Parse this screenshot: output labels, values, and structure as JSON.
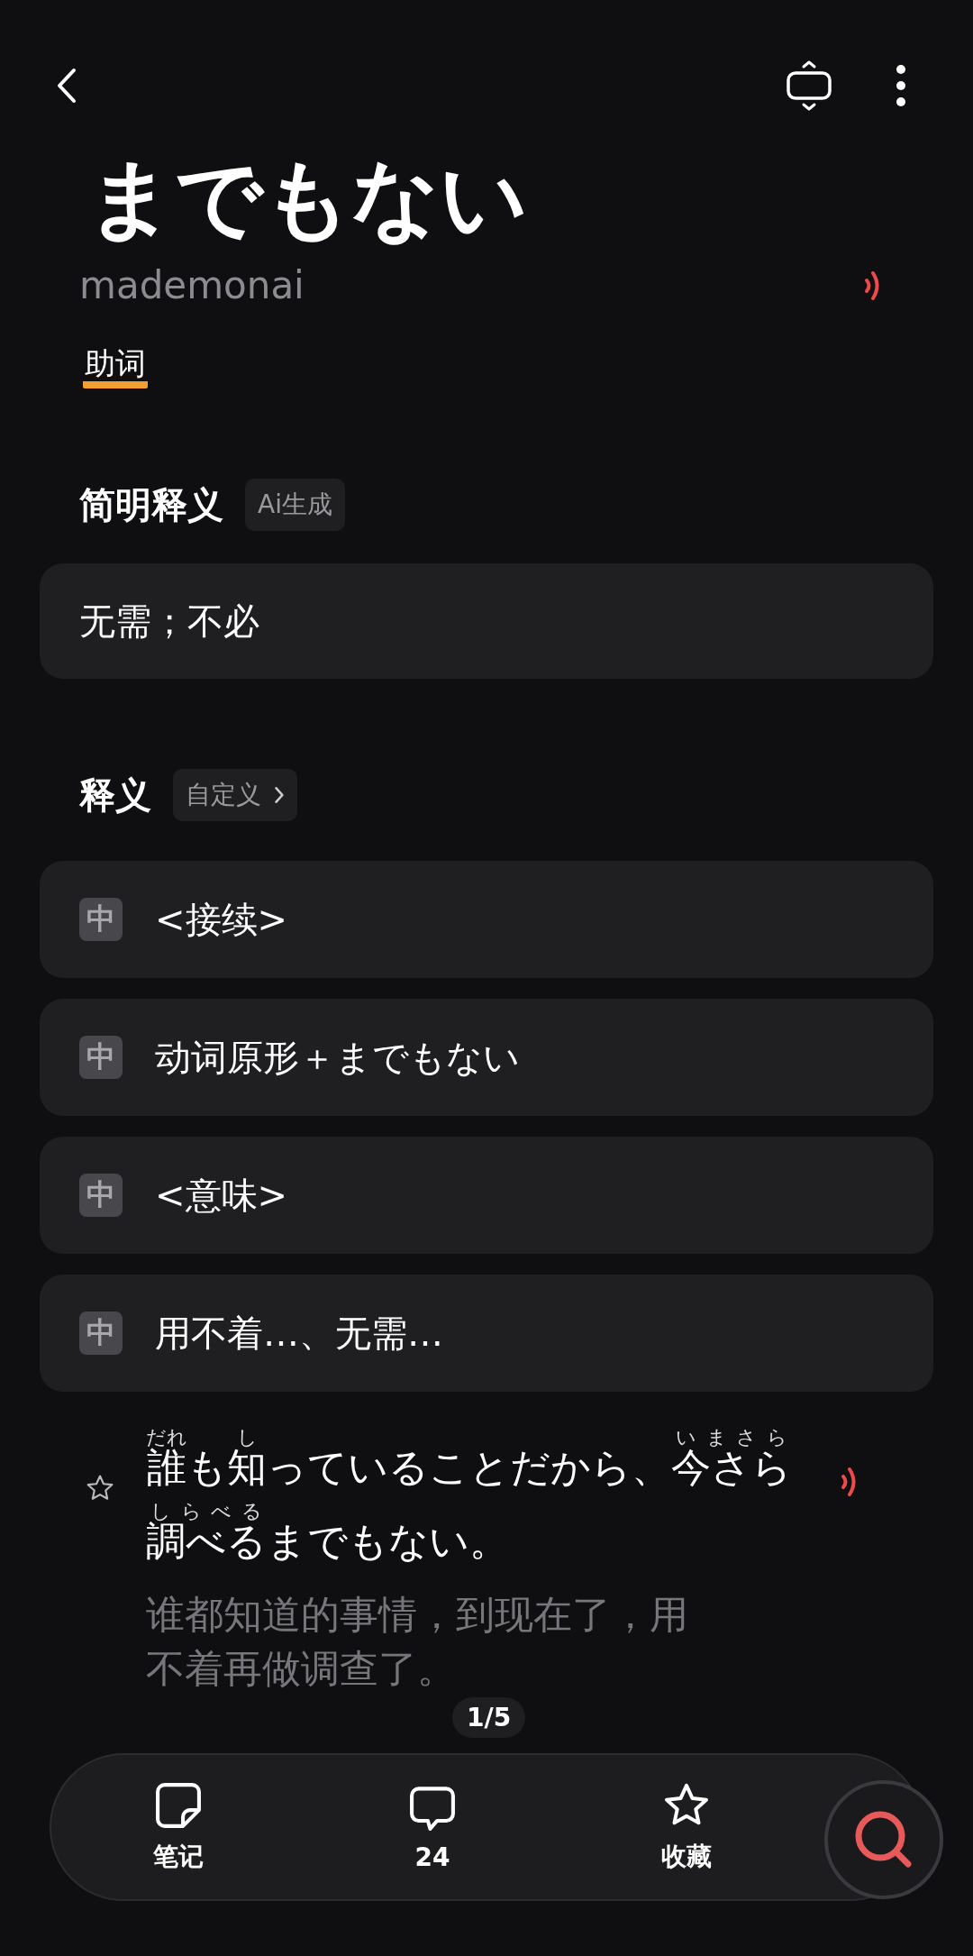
{
  "word": {
    "title": "までもない",
    "reading": "mademonai",
    "pos": "助词"
  },
  "brief": {
    "heading": "简明释义",
    "badge": "Ai生成",
    "text": "无需；不必"
  },
  "definitions": {
    "heading": "释义",
    "button": "自定义",
    "items": [
      {
        "tag": "中",
        "text": "<接续>"
      },
      {
        "tag": "中",
        "text": "动词原形＋までもない"
      },
      {
        "tag": "中",
        "text": "<意味>"
      },
      {
        "tag": "中",
        "text": "用不着…、无需…"
      }
    ]
  },
  "example": {
    "starred": false,
    "segments": [
      {
        "text": "誰",
        "ruby": "だれ"
      },
      {
        "text": "も"
      },
      {
        "text": "知",
        "ruby": "し"
      },
      {
        "text": "っていることだから、"
      },
      {
        "text": "今さら",
        "ruby": "いまさら"
      },
      {
        "text": "調べる",
        "ruby": "しらべる"
      },
      {
        "text": "までもない。"
      }
    ],
    "translation": "谁都知道的事情，到现在了，用不着再做调查了。",
    "pager": "1/5"
  },
  "bottom_bar": [
    {
      "kind": "note",
      "label": "笔记"
    },
    {
      "kind": "comment",
      "label": "24"
    },
    {
      "kind": "star",
      "label": "收藏"
    }
  ]
}
